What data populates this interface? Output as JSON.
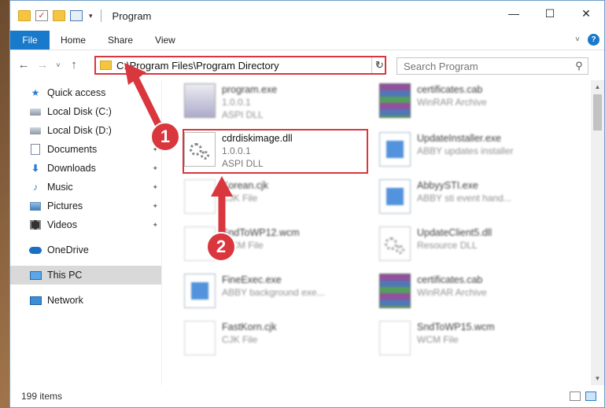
{
  "window": {
    "title": "Program"
  },
  "quick_access_toolbar": {
    "icons": [
      "folder-icon",
      "properties-check-icon",
      "new-folder-icon",
      "customize-icon"
    ]
  },
  "window_controls": {
    "minimize": "—",
    "maximize": "☐",
    "close": "✕"
  },
  "ribbon": {
    "tabs": [
      "File",
      "Home",
      "Share",
      "View"
    ],
    "expand": "˅",
    "help": "?"
  },
  "nav_buttons": {
    "back": "←",
    "forward": "→",
    "recent": "˅",
    "up": "↑"
  },
  "address": {
    "path": "C:\\Program Files\\Program Directory",
    "dropdown": "˅",
    "refresh": "↻"
  },
  "search": {
    "placeholder": "Search Program",
    "icon": "⚲"
  },
  "sidebar": {
    "items": [
      {
        "label": "Quick access",
        "icon": "star-icon",
        "pinned": false
      },
      {
        "label": "Local Disk (C:)",
        "icon": "drive-icon",
        "pinned": false
      },
      {
        "label": "Local Disk (D:)",
        "icon": "drive-icon",
        "pinned": false
      },
      {
        "label": "Documents",
        "icon": "documents-icon",
        "pinned": true
      },
      {
        "label": "Downloads",
        "icon": "downloads-icon",
        "pinned": true
      },
      {
        "label": "Music",
        "icon": "music-icon",
        "pinned": true
      },
      {
        "label": "Pictures",
        "icon": "pictures-icon",
        "pinned": true
      },
      {
        "label": "Videos",
        "icon": "videos-icon",
        "pinned": true
      },
      {
        "label": "OneDrive",
        "icon": "onedrive-icon",
        "pinned": false
      },
      {
        "label": "This PC",
        "icon": "this-pc-icon",
        "pinned": false,
        "selected": true
      },
      {
        "label": "Network",
        "icon": "network-icon",
        "pinned": false
      }
    ],
    "pin_glyph": "📌"
  },
  "files": [
    {
      "name": "program.exe",
      "line1": "1.0.0.1",
      "line2": "ASPI DLL",
      "icon": "exe-icon",
      "blurred": true
    },
    {
      "name": "certificates.cab",
      "line1": "WinRAR Archive",
      "line2": "",
      "icon": "winrar-icon",
      "blurred": true
    },
    {
      "name": "cdrdiskimage.dll",
      "line1": "1.0.0.1",
      "line2": "ASPI DLL",
      "icon": "dll-gears-icon",
      "blurred": false,
      "highlighted": true
    },
    {
      "name": "UpdateInstaller.exe",
      "line1": "ABBY updates installer",
      "line2": "",
      "icon": "window-app-icon",
      "blurred": true
    },
    {
      "name": "Korean.cjk",
      "line1": "CJK File",
      "line2": "",
      "icon": "blank-file-icon",
      "blurred": true
    },
    {
      "name": "AbbyySTI.exe",
      "line1": "ABBY sti event hand...",
      "line2": "",
      "icon": "window-app-icon",
      "blurred": true
    },
    {
      "name": "SndToWP12.wcm",
      "line1": "WCM File",
      "line2": "",
      "icon": "blank-file-icon",
      "blurred": true
    },
    {
      "name": "UpdateClient5.dll",
      "line1": "Resource DLL",
      "line2": "",
      "icon": "dll-gears-icon",
      "blurred": true
    },
    {
      "name": "FineExec.exe",
      "line1": "ABBY background exe...",
      "line2": "",
      "icon": "window-app-icon",
      "blurred": true
    },
    {
      "name": "certificates.cab",
      "line1": "WinRAR Archive",
      "line2": "",
      "icon": "winrar-icon",
      "blurred": true
    },
    {
      "name": "FastKorn.cjk",
      "line1": "CJK File",
      "line2": "",
      "icon": "blank-file-icon",
      "blurred": true
    },
    {
      "name": "SndToWP15.wcm",
      "line1": "WCM File",
      "line2": "",
      "icon": "blank-file-icon",
      "blurred": true
    }
  ],
  "annotations": {
    "step1": "1",
    "step2": "2",
    "color": "#d9363e"
  },
  "status": {
    "item_count": "199 items"
  },
  "colors": {
    "accent": "#1979ca",
    "highlight": "#d9363e",
    "selection": "#d9d9d9"
  }
}
